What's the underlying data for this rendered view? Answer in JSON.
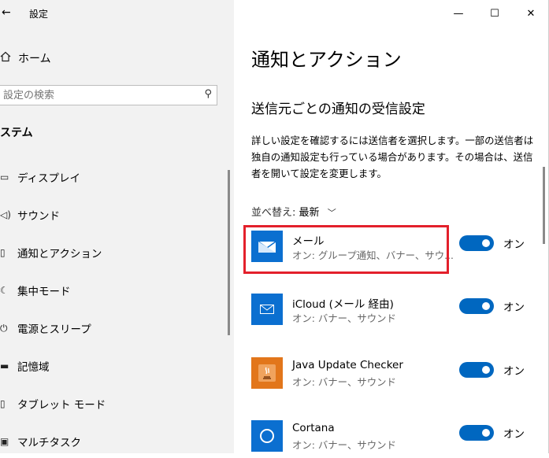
{
  "window": {
    "title": "設定",
    "minimize": "—",
    "maximize": "☐",
    "close": "✕"
  },
  "sidebar": {
    "home_label": "ホーム",
    "search_placeholder": "設定の検索",
    "section": "ステム",
    "items": [
      {
        "label": "ディスプレイ",
        "icon": "display-icon"
      },
      {
        "label": "サウンド",
        "icon": "speaker-icon"
      },
      {
        "label": "通知とアクション",
        "icon": "notification-icon"
      },
      {
        "label": "集中モード",
        "icon": "moon-icon"
      },
      {
        "label": "電源とスリープ",
        "icon": "power-icon"
      },
      {
        "label": "記憶域",
        "icon": "storage-icon"
      },
      {
        "label": "タブレット モード",
        "icon": "tablet-icon"
      },
      {
        "label": "マルチタスク",
        "icon": "multitask-icon"
      }
    ]
  },
  "main": {
    "title": "通知とアクション",
    "subhead": "送信元ごとの通知の受信設定",
    "description": "詳しい設定を確認するには送信者を選択します。一部の送信者は独自の通知設定も行っている場合があります。その場合は、送信者を開いて設定を変更します。",
    "sort_label": "並べ替え:",
    "sort_value": "最新",
    "apps": [
      {
        "name": "メール",
        "sub": "オン: グループ通知、バナー、サウ...",
        "toggle": "オン",
        "icon": "mail-icon",
        "color": "#0b6fd0"
      },
      {
        "name": "iCloud (メール 経由)",
        "sub": "オン: バナー、サウンド",
        "toggle": "オン",
        "icon": "envelope-icon",
        "color": "#0b6fd0"
      },
      {
        "name": "Java Update Checker",
        "sub": "オン: バナー、サウンド",
        "toggle": "オン",
        "icon": "java-icon",
        "color": "#e2761b"
      },
      {
        "name": "Cortana",
        "sub": "オン: バナー、サウンド",
        "toggle": "オン",
        "icon": "cortana-icon",
        "color": "#0b6fd0"
      }
    ]
  },
  "colors": {
    "accent": "#0067c0",
    "highlight": "#e3202b",
    "sidebar_bg": "#f2f2f2"
  }
}
